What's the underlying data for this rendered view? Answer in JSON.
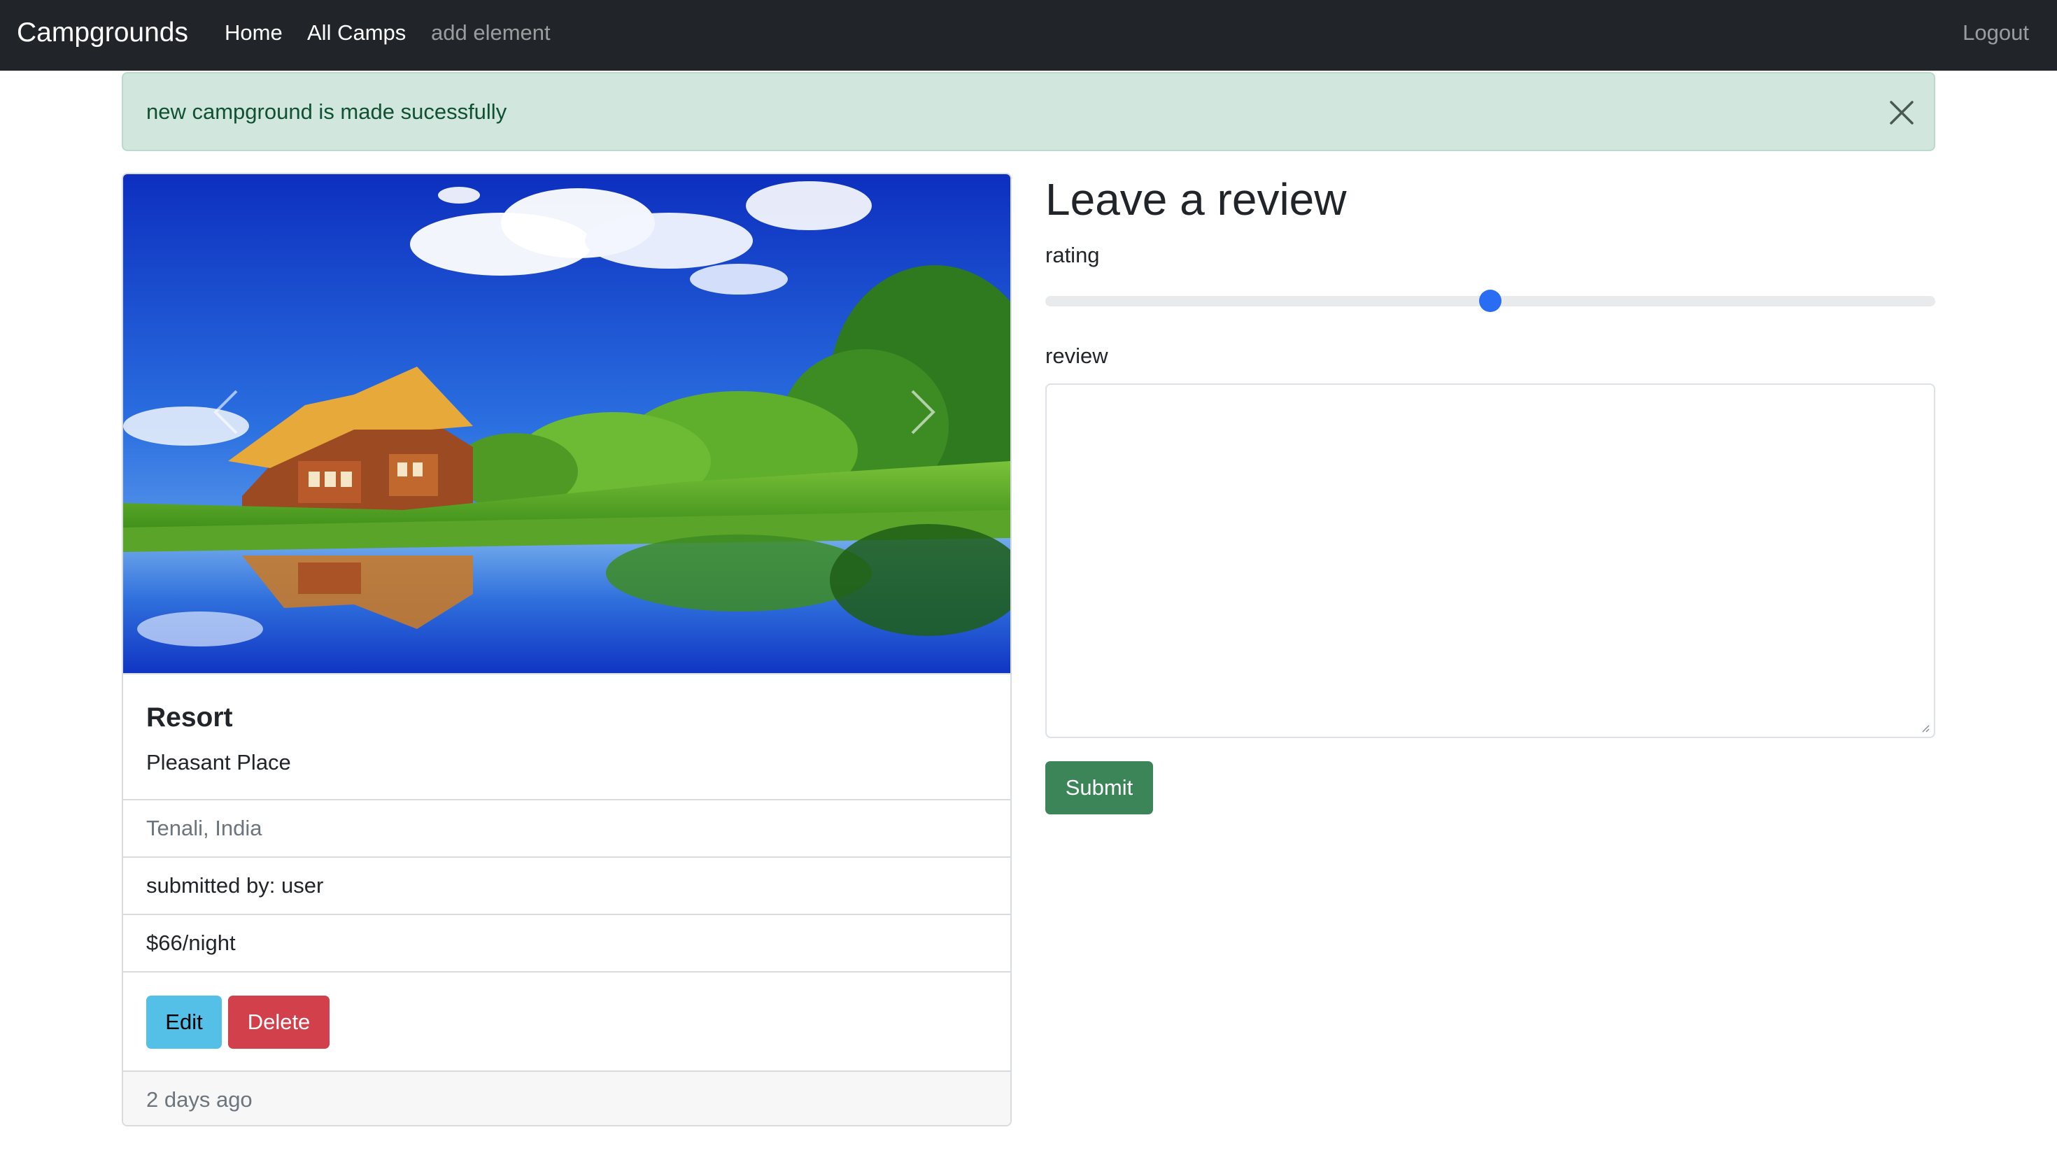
{
  "navbar": {
    "brand": "Campgrounds",
    "links": [
      "Home",
      "All Camps",
      "add element"
    ],
    "logout": "Logout"
  },
  "alert": {
    "message": "new campground is made sucessfully"
  },
  "campground": {
    "title": "Resort",
    "description": "Pleasant Place",
    "location": "Tenali, India",
    "submitted_by": "submitted by: user",
    "price": "$66/night",
    "edit_label": "Edit",
    "delete_label": "Delete",
    "posted": "2 days ago"
  },
  "review_form": {
    "heading": "Leave a review",
    "rating_label": "rating",
    "rating_value": 0.5,
    "review_label": "review",
    "review_value": "",
    "submit_label": "Submit"
  },
  "colors": {
    "navbar": "#212529",
    "alert_bg": "#d1e7dd",
    "edit": "#54c0e8",
    "delete": "#d1404b",
    "submit": "#3b8558",
    "range_thumb": "#2a6df5"
  },
  "icons": [
    "close-icon",
    "chevron-left-icon",
    "chevron-right-icon"
  ]
}
